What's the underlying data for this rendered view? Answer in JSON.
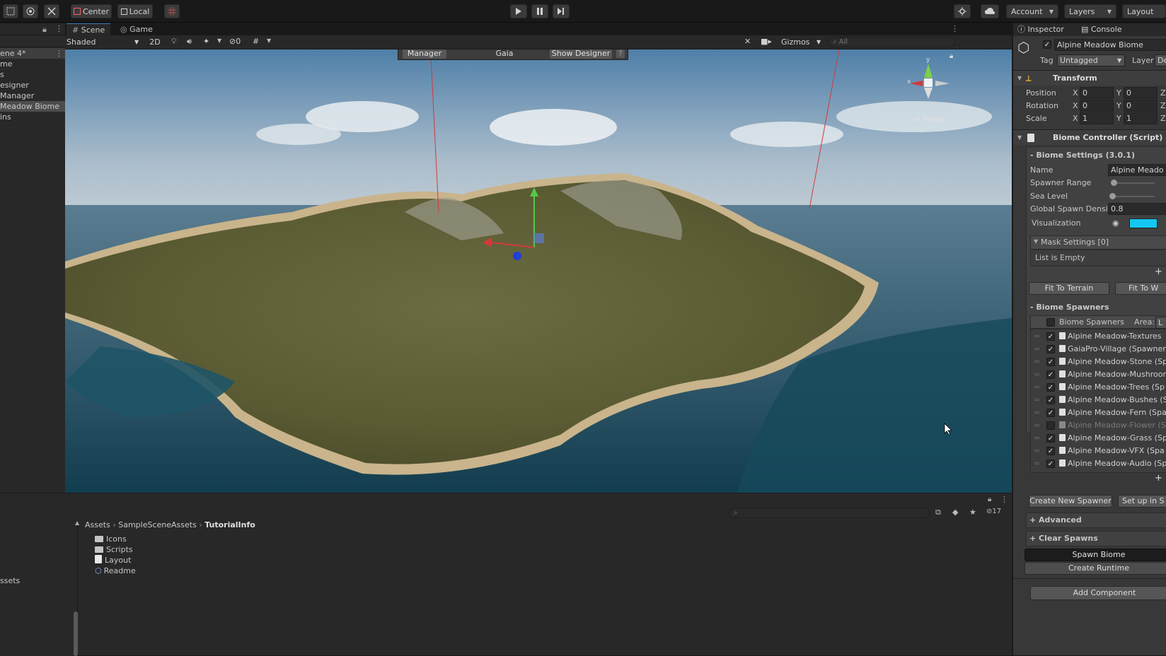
{
  "toolbar": {
    "pivot_center": "Center",
    "pivot_local": "Local",
    "account": "Account",
    "layers": "Layers",
    "layout": "Layout"
  },
  "hierarchy": {
    "items": [
      "ene 4*",
      "me",
      "s",
      "esigner",
      " Manager",
      " Meadow Biome",
      "ins"
    ]
  },
  "scene": {
    "tab_scene": "Scene",
    "tab_game": "Game",
    "shading_mode": "Shaded",
    "mode_2d": "2D",
    "hidden_count": "0",
    "gizmos": "Gizmos",
    "search_placeholder": "All",
    "overlay_manager": "Manager",
    "overlay_gaia": "Gaia",
    "overlay_show_designer": "Show Designer",
    "overlay_help": "?",
    "axis_y": "y",
    "axis_x": "x",
    "persp": "< Persp"
  },
  "project": {
    "hidden_count": "17",
    "breadcrumb": [
      "Assets",
      "SampleSceneAssets",
      "TutorialInfo"
    ],
    "files": [
      {
        "name": "Icons",
        "icon": "folder-icon"
      },
      {
        "name": "Scripts",
        "icon": "folder-icon"
      },
      {
        "name": "Layout",
        "icon": "file-icon"
      },
      {
        "name": "Readme",
        "icon": "asset-icon"
      }
    ],
    "left_label": "ssets"
  },
  "inspector": {
    "tab_inspector": "Inspector",
    "tab_console": "Console",
    "object_name": "Alpine Meadow Biome",
    "tag_label": "Tag",
    "tag_value": "Untagged",
    "layer_label": "Layer",
    "layer_value": "Def",
    "transform": {
      "title": "Transform",
      "rows": [
        {
          "label": "Position",
          "x": "0",
          "y": "0"
        },
        {
          "label": "Rotation",
          "x": "0",
          "y": "0"
        },
        {
          "label": "Scale",
          "x": "1",
          "y": "1"
        }
      ],
      "axis_x": "X",
      "axis_y": "Y",
      "axis_z": "Z"
    },
    "biome_controller": {
      "title": "Biome Controller (Script)",
      "settings_title": "- Biome Settings   (3.0.1)",
      "name_label": "Name",
      "name_value": "Alpine Meado",
      "spawner_range_label": "Spawner Range",
      "sea_level_label": "Sea Level",
      "spawn_density_label": "Global Spawn Densit",
      "spawn_density_value": "0.8",
      "visualization_label": "Visualization",
      "visualization_color": "#15c8f2",
      "mask_settings": "Mask Settings [0]",
      "list_empty": "List is Empty",
      "plus": "+",
      "fit_terrain": "Fit To Terrain",
      "fit_world": "Fit To W",
      "spawners_title": "- Biome Spawners",
      "spawners_header": "Biome Spawners",
      "area_label": "Area:",
      "area_value": "L",
      "spawners": [
        {
          "name": "Alpine Meadow-Textures",
          "checked": true
        },
        {
          "name": "GaiaPro-Village (Spawner",
          "checked": true
        },
        {
          "name": "Alpine Meadow-Stone (Sp",
          "checked": true
        },
        {
          "name": "Alpine Meadow-Mushroor",
          "checked": true
        },
        {
          "name": "Alpine Meadow-Trees (Sp",
          "checked": true
        },
        {
          "name": "Alpine Meadow-Bushes (S",
          "checked": true
        },
        {
          "name": "Alpine Meadow-Fern (Spa",
          "checked": true
        },
        {
          "name": "Alpine Meadow-Flower (S",
          "checked": false
        },
        {
          "name": "Alpine Meadow-Grass (Sp",
          "checked": true
        },
        {
          "name": "Alpine Meadow-VFX (Spa",
          "checked": true
        },
        {
          "name": "Alpine Meadow-Audio (Sp",
          "checked": true
        }
      ],
      "create_spawner": "Create New Spawner",
      "setup": "Set up in S",
      "advanced": "+ Advanced",
      "clear_spawns": "+ Clear Spawns",
      "spawn_biome": "Spawn Biome",
      "create_runtime": "Create Runtime"
    },
    "add_component": "Add Component"
  }
}
